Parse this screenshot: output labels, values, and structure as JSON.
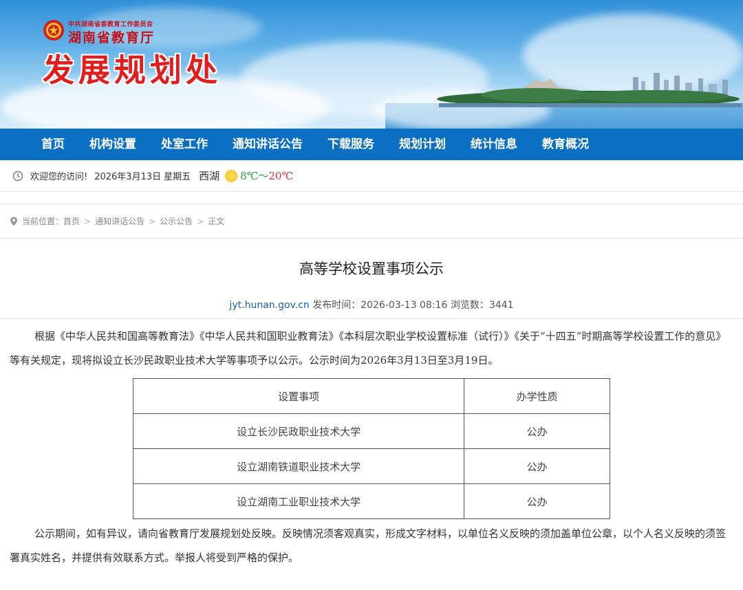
{
  "header": {
    "org_small": "中共湖南省委教育工作委员会",
    "org_name": "湖南省教育厅",
    "dept_title": "发展规划处"
  },
  "nav": {
    "items": [
      "首页",
      "机构设置",
      "处室工作",
      "通知讲话公告",
      "下载服务",
      "规划计划",
      "统计信息",
      "教育概况"
    ]
  },
  "infobar": {
    "welcome": "欢迎您的访问!",
    "date": "2026年3月13日",
    "weekday": "星期五",
    "city": "西湖",
    "weather_icon": "sun-icon",
    "temp_low": "8℃",
    "temp_sep": "～",
    "temp_high": "20℃"
  },
  "breadcrumb": {
    "label": "当前位置：",
    "items": [
      "首页",
      "通知讲话公告",
      "公示公告",
      "正文"
    ],
    "separator": ">"
  },
  "article": {
    "title": "高等学校设置事项公示",
    "source": "jyt.hunan.gov.cn",
    "publish_label": "发布时间：",
    "publish_time": "2026-03-13 08:16",
    "views_label": "浏览数：",
    "views": "3441",
    "paragraph1": "根据《中华人民共和国高等教育法》《中华人民共和国职业教育法》《本科层次职业学校设置标准（试行）》《关于“十四五”时期高等学校设置工作的意见》等有关规定，现将拟设立长沙民政职业技术大学等事项予以公示。公示时间为2026年3月13日至3月19日。",
    "table": {
      "headers": [
        "设置事项",
        "办学性质"
      ],
      "rows": [
        [
          "设立长沙民政职业技术大学",
          "公办"
        ],
        [
          "设立湖南铁道职业技术大学",
          "公办"
        ],
        [
          "设立湖南工业职业技术大学",
          "公办"
        ]
      ]
    },
    "paragraph2": "公示期间，如有异议，请向省教育厅发展规划处反映。反映情况须客观真实，形成文字材料，以单位名义反映的须加盖单位公章，以个人名义反映的须签署真实姓名，并提供有效联系方式。举报人将受到严格的保护。"
  },
  "colors": {
    "nav_bg": "#0b6fc2",
    "title_red": "#e01e1e",
    "temp_low": "#2a9a3a",
    "temp_high": "#dd3333",
    "link_blue": "#1a5fa8"
  }
}
